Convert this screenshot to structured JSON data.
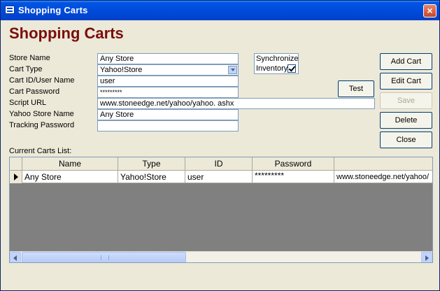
{
  "window": {
    "title": "Shopping Carts",
    "close_label": "×"
  },
  "form": {
    "heading": "Shopping Carts",
    "fields": {
      "store_name": {
        "label": "Store Name",
        "value": "Any Store"
      },
      "cart_type": {
        "label": "Cart Type",
        "value": "Yahoo!Store"
      },
      "cart_id": {
        "label": "Cart ID/User Name",
        "value": "user"
      },
      "cart_password": {
        "label": "Cart Password",
        "value": "*********"
      },
      "script_url": {
        "label": "Script URL",
        "value": "www.stoneedge.net/yahoo/yahoo. ashx"
      },
      "yahoo_store_name": {
        "label": "Yahoo Store Name",
        "value": "Any Store"
      },
      "tracking_password": {
        "label": "Tracking Password",
        "value": ""
      }
    },
    "sync": {
      "line1": "Synchronize",
      "line2": "Inventory",
      "checked": true
    },
    "buttons": {
      "test": "Test",
      "add_cart": "Add Cart",
      "edit_cart": "Edit Cart",
      "save": "Save",
      "delete": "Delete",
      "close": "Close"
    },
    "list_label": "Current Carts List:",
    "grid": {
      "columns": [
        "Name",
        "Type",
        "ID",
        "Password",
        ""
      ],
      "rows": [
        [
          "Any Store",
          "Yahoo!Store",
          "user",
          "*********",
          "www.stoneedge.net/yahoo/"
        ]
      ]
    }
  }
}
